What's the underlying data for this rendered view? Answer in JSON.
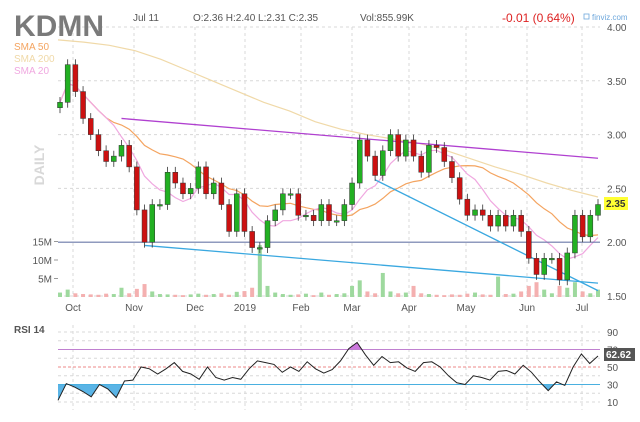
{
  "header": {
    "ticker": "KDMN",
    "date": "Jul 11",
    "ohlc": "O:2.36 H:2.40 L:2.31 C:2.35",
    "volume": "Vol:855.99K",
    "change": "-0.01 (0.64%)",
    "brand": "finviz.com",
    "period_watermark": "DAILY"
  },
  "legend": [
    {
      "label": "SMA 50",
      "color": "#f4a460"
    },
    {
      "label": "SMA 200",
      "color": "#f0d9a8"
    },
    {
      "label": "SMA 20",
      "color": "#f0a8e0"
    }
  ],
  "colors": {
    "up": "#22b022",
    "down": "#cc1111",
    "trend_resist": "#b040d0",
    "trend_support": "#3aa8e0",
    "level_line": "#6a78a8",
    "change": "#dd2222"
  },
  "chart_data": {
    "type": "candlestick",
    "title": "KDMN",
    "x_labels": [
      "Oct",
      "Nov",
      "Dec",
      "2019",
      "Feb",
      "Mar",
      "Apr",
      "May",
      "Jun",
      "Jul"
    ],
    "price_ticks": [
      "4.00",
      "3.50",
      "3.00",
      "2.50",
      "2.00",
      "1.50"
    ],
    "price_range": [
      1.5,
      4.0
    ],
    "volume_ticks": [
      "15M",
      "10M",
      "5M"
    ],
    "last_price_label": "2.35",
    "closes": [
      3.3,
      3.65,
      3.4,
      3.15,
      3.0,
      2.85,
      2.75,
      2.8,
      2.9,
      2.7,
      2.3,
      2.0,
      2.35,
      2.35,
      2.65,
      2.55,
      2.45,
      2.5,
      2.7,
      2.45,
      2.55,
      2.35,
      2.1,
      2.45,
      2.1,
      1.95,
      1.95,
      2.2,
      2.3,
      2.45,
      2.45,
      2.25,
      2.25,
      2.2,
      2.35,
      2.2,
      2.2,
      2.35,
      2.55,
      2.95,
      2.8,
      2.62,
      2.85,
      3.0,
      2.8,
      2.95,
      2.8,
      2.65,
      2.9,
      2.88,
      2.75,
      2.6,
      2.4,
      2.25,
      2.3,
      2.25,
      2.15,
      2.25,
      2.15,
      2.25,
      2.1,
      1.85,
      1.7,
      1.85,
      1.85,
      1.65,
      1.9,
      2.25,
      2.05,
      2.25,
      2.35
    ],
    "volumes_m": [
      1.2,
      2.0,
      1.0,
      0.8,
      0.7,
      0.6,
      0.9,
      0.8,
      2.5,
      1.0,
      2.2,
      3.5,
      1.5,
      0.8,
      0.7,
      0.6,
      0.5,
      0.7,
      0.9,
      0.6,
      0.8,
      1.0,
      0.6,
      1.4,
      1.6,
      2.5,
      14.0,
      3.0,
      1.2,
      0.8,
      0.6,
      0.7,
      0.9,
      0.5,
      1.2,
      0.6,
      0.8,
      1.0,
      3.0,
      4.5,
      1.5,
      1.0,
      6.5,
      1.5,
      1.0,
      1.2,
      3.0,
      1.0,
      0.8,
      0.6,
      0.5,
      0.7,
      0.6,
      0.9,
      1.2,
      0.7,
      0.6,
      5.5,
      0.8,
      0.9,
      1.5,
      3.0,
      4.0,
      2.0,
      1.0,
      3.0,
      2.5,
      4.0,
      1.5,
      1.0,
      2.0
    ],
    "sma200": [
      3.88,
      3.86,
      3.83,
      3.78,
      3.7,
      3.6,
      3.5,
      3.4,
      3.3,
      3.22,
      3.12,
      3.05,
      3.0,
      2.96,
      2.92,
      2.86,
      2.78,
      2.7,
      2.63,
      2.55,
      2.48,
      2.42
    ],
    "trendlines": [
      {
        "name": "resistance",
        "from": [
          8,
          3.15
        ],
        "to": [
          70,
          2.78
        ]
      },
      {
        "name": "support-long",
        "from": [
          11,
          1.97
        ],
        "to": [
          70,
          1.62
        ]
      },
      {
        "name": "support-short",
        "from": [
          41,
          2.58
        ],
        "to": [
          70,
          1.55
        ]
      }
    ],
    "level_line": 2.0,
    "rsi": {
      "label": "RSI 14",
      "current": "62.62",
      "ticks": [
        "90",
        "70",
        "50",
        "30",
        "10"
      ],
      "overbought": 70,
      "midline": 50,
      "oversold": 30,
      "values": [
        12,
        31,
        27,
        22,
        16,
        30,
        25,
        15,
        34,
        35,
        50,
        48,
        42,
        48,
        55,
        45,
        42,
        36,
        50,
        38,
        35,
        38,
        36,
        48,
        57,
        55,
        53,
        44,
        50,
        45,
        56,
        48,
        43,
        47,
        57,
        71,
        78,
        64,
        52,
        62,
        55,
        56,
        49,
        45,
        55,
        56,
        50,
        40,
        32,
        30,
        40,
        38,
        35,
        45,
        46,
        42,
        52,
        44,
        33,
        23,
        33,
        29,
        50,
        65,
        54,
        62.62
      ]
    }
  }
}
